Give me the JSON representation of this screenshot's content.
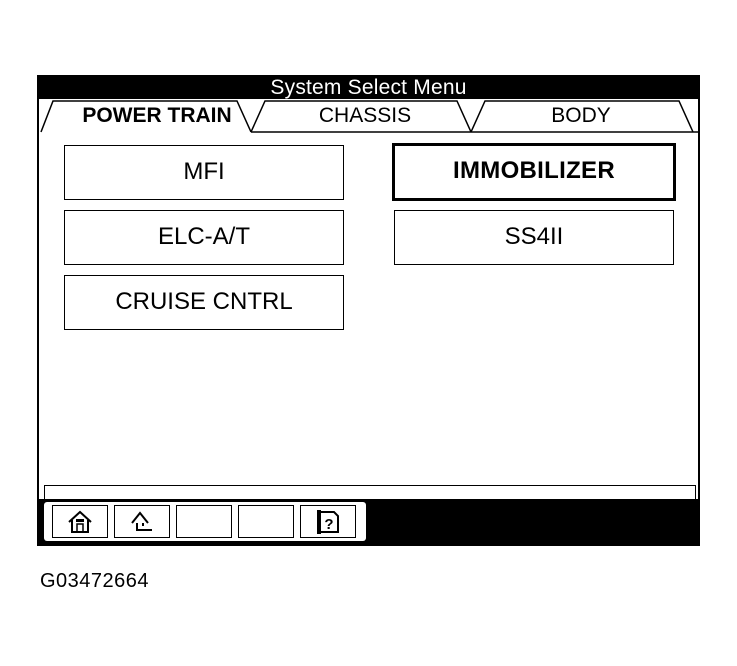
{
  "window": {
    "title": "System Select Menu"
  },
  "tabs": [
    {
      "label": "POWER TRAIN",
      "active": true
    },
    {
      "label": "CHASSIS",
      "active": false
    },
    {
      "label": "BODY",
      "active": false
    }
  ],
  "systems": {
    "mfi": "MFI",
    "immobilizer": "IMMOBILIZER",
    "elc_at": "ELC-A/T",
    "ss4ii": "SS4II",
    "cruise": "CRUISE CNTRL",
    "selected": "IMMOBILIZER"
  },
  "toolbar": {
    "icons": [
      "home-icon",
      "back-arrow-icon",
      "blank",
      "blank",
      "help-icon"
    ]
  },
  "figure": {
    "caption": "G03472664"
  }
}
